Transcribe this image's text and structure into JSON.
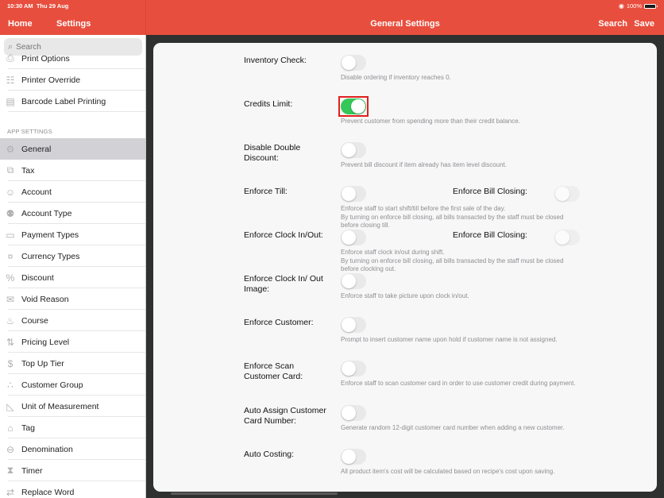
{
  "status_bar": {
    "time": "10:30 AM",
    "date": "Thu 29 Aug",
    "battery": "100%"
  },
  "nav": {
    "home": "Home",
    "settings": "Settings",
    "title": "General Settings",
    "search": "Search",
    "save": "Save"
  },
  "sidebar": {
    "search_placeholder": "Search",
    "section_header": "APP SETTINGS",
    "top_items": [
      {
        "label": "Print Options",
        "icon": "print-options-icon"
      },
      {
        "label": "Printer Override",
        "icon": "document-icon"
      },
      {
        "label": "Barcode Label Printing",
        "icon": "barcode-label-icon"
      }
    ],
    "items": [
      {
        "label": "General",
        "icon": "gear-icon",
        "selected": true
      },
      {
        "label": "Tax",
        "icon": "tax-icon"
      },
      {
        "label": "Account",
        "icon": "user-circle-icon"
      },
      {
        "label": "Account Type",
        "icon": "account-type-icon"
      },
      {
        "label": "Payment Types",
        "icon": "card-icon"
      },
      {
        "label": "Currency Types",
        "icon": "currency-icon"
      },
      {
        "label": "Discount",
        "icon": "percent-icon"
      },
      {
        "label": "Void Reason",
        "icon": "void-icon"
      },
      {
        "label": "Course",
        "icon": "cutlery-icon"
      },
      {
        "label": "Pricing Level",
        "icon": "arrows-icon"
      },
      {
        "label": "Top Up Tier",
        "icon": "envelope-dollar-icon"
      },
      {
        "label": "Customer Group",
        "icon": "group-icon"
      },
      {
        "label": "Unit of Measurement",
        "icon": "ruler-triangle-icon"
      },
      {
        "label": "Tag",
        "icon": "tag-icon"
      },
      {
        "label": "Denomination",
        "icon": "money-bag-icon"
      },
      {
        "label": "Timer",
        "icon": "hourglass-icon"
      },
      {
        "label": "Replace Word",
        "icon": "replace-icon"
      }
    ]
  },
  "settings": [
    {
      "label": "Inventory Check:",
      "desc": "Disable ordering if inventory reaches 0.",
      "on": false
    },
    {
      "label": "Credits Limit:",
      "desc": "Prevent customer from spending more than their credit balance.",
      "on": true
    },
    {
      "label": "Disable Double Discount:",
      "desc": "Prevent bill discount if item already has item level discount.",
      "on": false
    },
    {
      "label": "Enforce Till:",
      "desc": "Enforce staff to start shift/till before the first sale of the day.\nBy turning on enforce bill closing, all bills transacted by the staff must be closed before closing till.",
      "on": false,
      "secondary_label": "Enforce Bill Closing:",
      "secondary_on": false
    },
    {
      "label": "Enforce Clock In/Out:",
      "desc": "Enforce staff clock in/out during shift.\nBy turning on enforce bill closing, all bills transacted by the staff must be closed before clocking out.",
      "on": false,
      "secondary_label": "Enforce Bill Closing:",
      "secondary_on": false
    },
    {
      "label": "Enforce Clock In/ Out Image:",
      "desc": "Enforce staff to take picture upon clock in/out.",
      "on": false
    },
    {
      "label": "Enforce Customer:",
      "desc": "Prompt to insert customer name upon hold if customer name is not assigned.",
      "on": false
    },
    {
      "label": "Enforce Scan Customer Card:",
      "desc": "Enforce staff to scan customer card in order to use customer credit during payment.",
      "on": false
    },
    {
      "label": "Auto Assign Customer Card Number:",
      "desc": "Generate random 12-digit customer card number when adding a new customer.",
      "on": false
    },
    {
      "label": "Auto Costing:",
      "desc": "All product item's cost will be calculated based on recipe's cost upon saving.",
      "on": false
    }
  ],
  "colors": {
    "accent": "#e84e3d",
    "toggle_on": "#34c759",
    "highlight": "#e0201f"
  }
}
